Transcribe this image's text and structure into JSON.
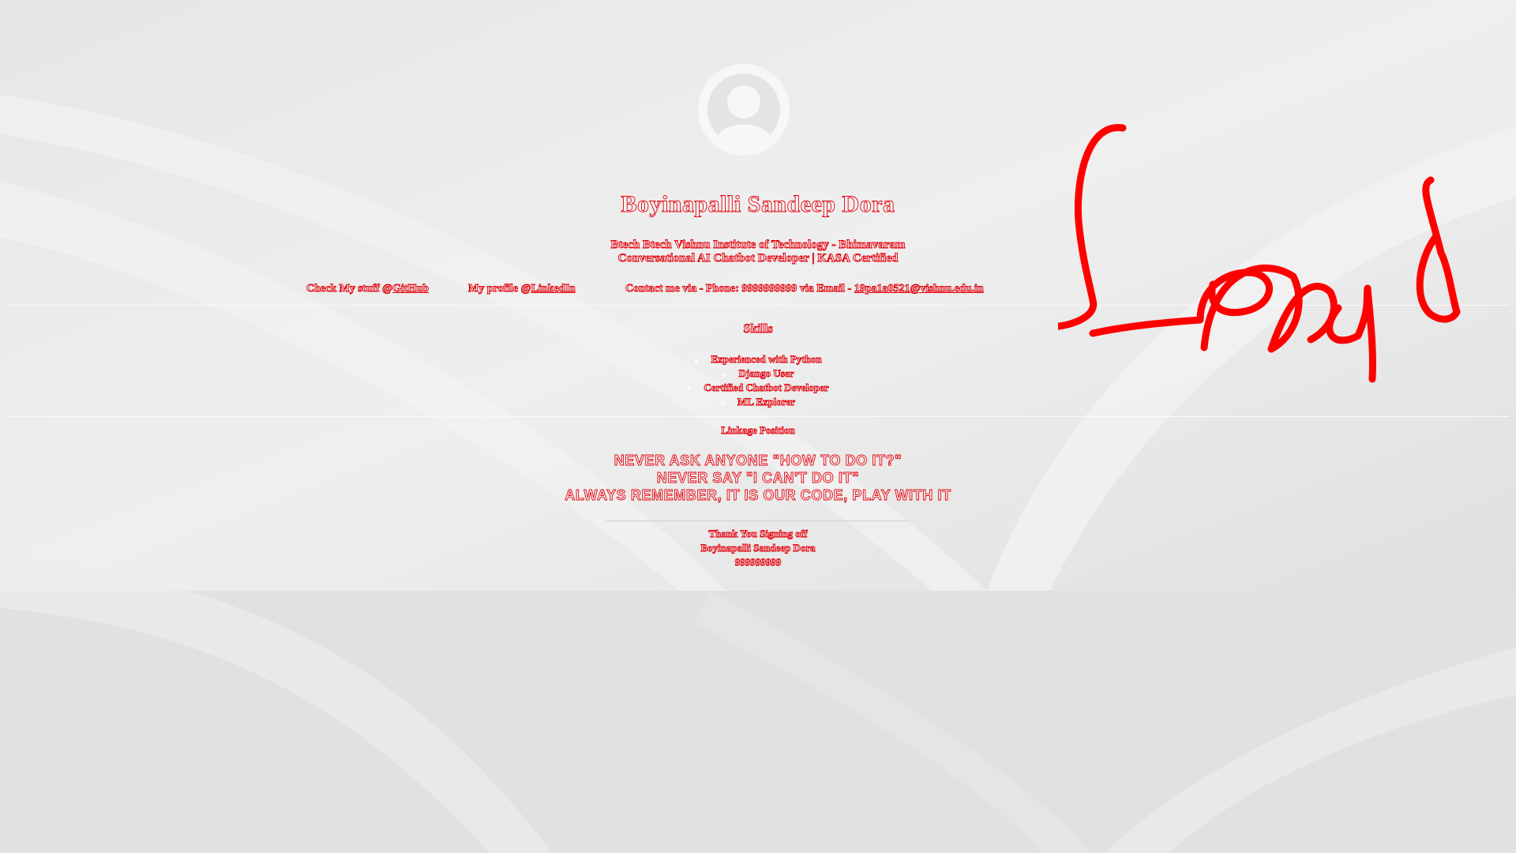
{
  "profile": {
    "name": "Boyinapalli Sandeep Dora",
    "education": "Btech Btech Vishnu Institute of Technology - Bhimavaram",
    "certification": "Conversational AI Chatbot Developer | KASA Certified"
  },
  "links": {
    "github_prefix": "Check My stuff @",
    "github_label": "GitHub",
    "linkedin_prefix": "My profile @",
    "linkedin_label": "LinkedIn",
    "contact_prefix": "Contact me via - Phone: 9999999999 via Email - ",
    "email": "19pa1a0521@vishnu.edu.in"
  },
  "skills": {
    "title": "Skills",
    "items": [
      "Experienced with Python",
      "Django User",
      "Certified Chatbot Developer",
      "ML Explorer"
    ]
  },
  "linkage_text": "Linkage Position",
  "motto": {
    "line1": "NEVER ASK ANYONE \"HOW TO DO IT?\"",
    "line2": "NEVER SAY \"I CAN'T DO IT\"",
    "line3": "ALWAYS REMEMBER, IT IS OUR CODE, PLAY WITH IT"
  },
  "footer": {
    "thanks": "Thank You Signing off",
    "name": "Boyinapalli Sandeep Dora",
    "id": "999999999"
  },
  "signature_text": "Send",
  "colors": {
    "background": "#e2e2e2",
    "text_outline": "#e3000b",
    "signature": "#ff0000",
    "avatar": "#f7f7f7"
  }
}
